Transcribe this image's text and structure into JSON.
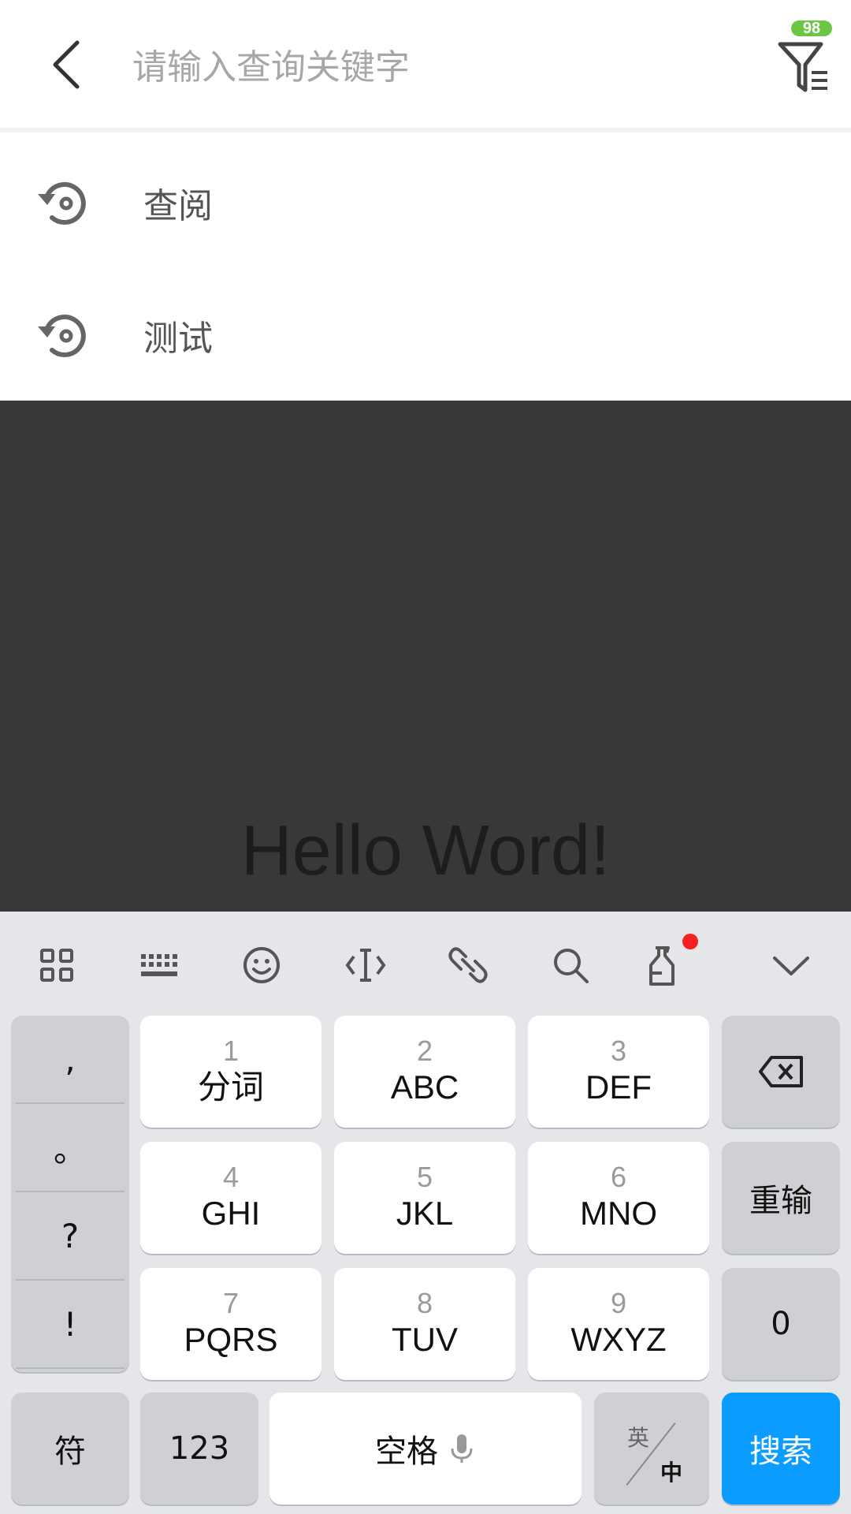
{
  "header": {
    "search_placeholder": "请输入查询关键字",
    "filter_badge": "98"
  },
  "history": {
    "items": [
      {
        "label": "查阅"
      },
      {
        "label": "测试"
      }
    ]
  },
  "content": {
    "hello_text": "Hello Word!"
  },
  "keyboard": {
    "toolbar_icons": [
      "grid-icon",
      "keyboard-icon",
      "emoji-icon",
      "cursor-icon",
      "link-icon",
      "search-icon",
      "bottle-icon",
      "collapse-chevron-icon"
    ],
    "punctuation": [
      ",",
      "。",
      "?",
      "!"
    ],
    "keys": [
      {
        "num": "1",
        "letters": "分词"
      },
      {
        "num": "2",
        "letters": "ABC"
      },
      {
        "num": "3",
        "letters": "DEF"
      },
      {
        "num": "4",
        "letters": "GHI"
      },
      {
        "num": "5",
        "letters": "JKL"
      },
      {
        "num": "6",
        "letters": "MNO"
      },
      {
        "num": "7",
        "letters": "PQRS"
      },
      {
        "num": "8",
        "letters": "TUV"
      },
      {
        "num": "9",
        "letters": "WXYZ"
      }
    ],
    "retype_label": "重输",
    "zero_label": "0",
    "symbol_label": "符",
    "numbers_label": "123",
    "space_label": "空格",
    "lang_en": "英",
    "lang_zh": "中",
    "search_label": "搜索",
    "colors": {
      "accent": "#0b9cff",
      "badge": "#6cc644",
      "dot": "#f5211f"
    }
  }
}
